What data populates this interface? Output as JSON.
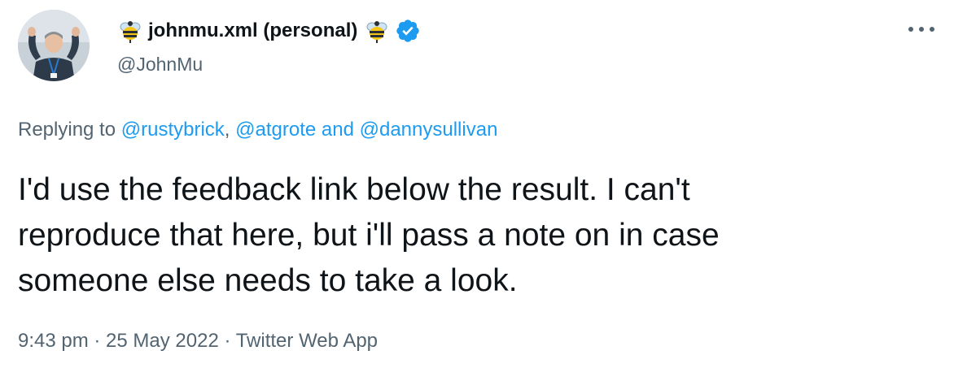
{
  "author": {
    "display_name": "johnmu.xml (personal)",
    "handle": "@JohnMu",
    "prefix_emoji_icon": "bee-icon",
    "suffix_emoji_icon": "bee-icon",
    "verified_icon": "verified-badge-icon"
  },
  "reply": {
    "prefix": "Replying to ",
    "mention1": "@rustybrick",
    "separator": ", ",
    "mention2": "@atgrote",
    "conjunction": " and ",
    "mention3": "@dannysullivan"
  },
  "tweet": {
    "lines": [
      "I'd use the feedback link below the result. I can't",
      "reproduce that here, but i'll pass a note on in case",
      "someone else needs to take a look."
    ]
  },
  "meta": {
    "time": "9:43 pm",
    "dot1": " · ",
    "date": "25 May 2022",
    "dot2": " · ",
    "source": "Twitter Web App"
  },
  "colors": {
    "link": "#1d9bf0",
    "secondary_text": "#536471",
    "primary_text": "#0f1419",
    "verified": "#1d9bf0"
  }
}
